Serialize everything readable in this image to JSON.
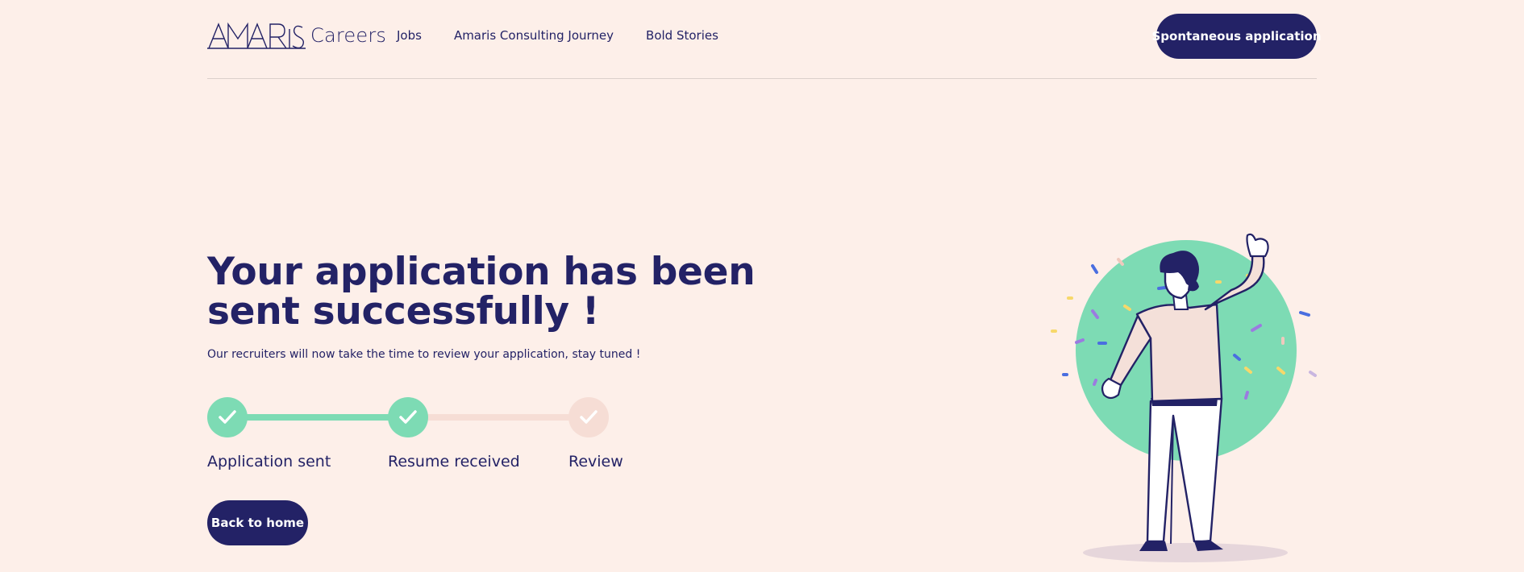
{
  "header": {
    "logo_text": "AMARIS",
    "logo_suffix": "Careers",
    "nav": [
      {
        "label": "Jobs"
      },
      {
        "label": "Amaris Consulting Journey"
      },
      {
        "label": "Bold Stories"
      }
    ],
    "cta_label": "Spontaneous application"
  },
  "main": {
    "title": "Your application has been sent successfully !",
    "subtitle": "Our recruiters will now take the time to review your application, stay tuned !",
    "steps": [
      {
        "label": "Application sent",
        "completed": true
      },
      {
        "label": "Resume received",
        "completed": true
      },
      {
        "label": "Review",
        "completed": false
      }
    ],
    "back_label": "Back to home"
  },
  "colors": {
    "background": "#fdefe9",
    "navy": "#232266",
    "green": "#7ddbb4",
    "pending": "#f6ddd5"
  },
  "icons": [
    "check-icon",
    "celebration-illustration"
  ]
}
